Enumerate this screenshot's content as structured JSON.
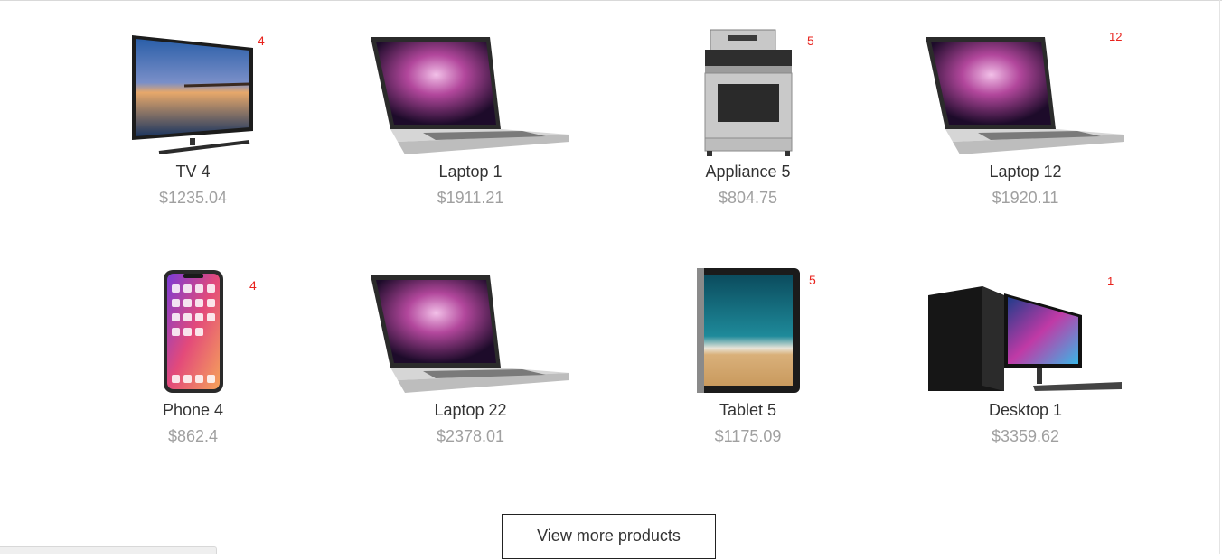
{
  "products": [
    {
      "name": "TV 4",
      "price": "$1235.04",
      "badge": "4",
      "icon": "tv-icon"
    },
    {
      "name": "Laptop 1",
      "price": "$1911.21",
      "badge": "",
      "icon": "laptop-icon"
    },
    {
      "name": "Appliance 5",
      "price": "$804.75",
      "badge": "5",
      "icon": "stove-icon"
    },
    {
      "name": "Laptop 12",
      "price": "$1920.11",
      "badge": "12",
      "icon": "laptop-icon"
    },
    {
      "name": "Phone 4",
      "price": "$862.4",
      "badge": "4",
      "icon": "phone-icon"
    },
    {
      "name": "Laptop 22",
      "price": "$2378.01",
      "badge": "",
      "icon": "laptop-icon"
    },
    {
      "name": "Tablet 5",
      "price": "$1175.09",
      "badge": "5",
      "icon": "tablet-icon"
    },
    {
      "name": "Desktop 1",
      "price": "$3359.62",
      "badge": "1",
      "icon": "desktop-icon"
    }
  ],
  "view_more_label": "View more products",
  "colors": {
    "badge": "#e8231d",
    "price": "#a0a0a0",
    "name": "#333333"
  }
}
